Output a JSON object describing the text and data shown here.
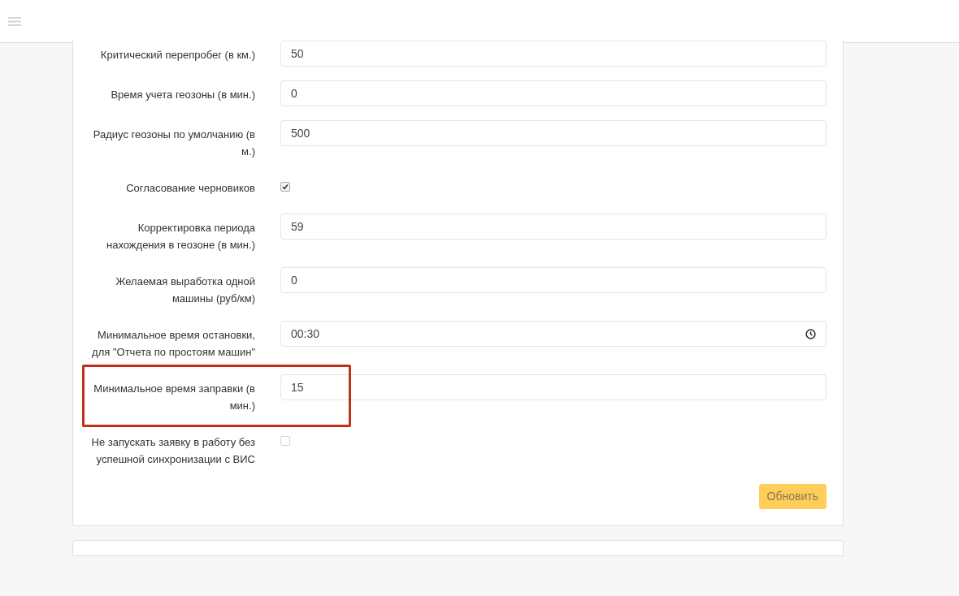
{
  "fields": [
    {
      "kind": "text",
      "label": "Критический перепробег (в км.)",
      "value": "50",
      "highlighted": false
    },
    {
      "kind": "text",
      "label": "Время учета геозоны (в мин.)",
      "value": "0",
      "highlighted": false
    },
    {
      "kind": "text",
      "label": "Радиус геозоны по умолчанию (в м.)",
      "value": "500",
      "highlighted": false
    },
    {
      "kind": "checkbox",
      "label": "Согласование черновиков",
      "checked": true,
      "highlighted": false
    },
    {
      "kind": "text",
      "label": "Корректировка периода нахождения в геозоне (в мин.)",
      "value": "59",
      "highlighted": false
    },
    {
      "kind": "text",
      "label": "Желаемая выработка одной машины (руб/км)",
      "value": "0",
      "highlighted": false
    },
    {
      "kind": "time",
      "label": "Минимальное время остановки, для \"Отчета по простоям машин\"",
      "value": "00:30",
      "highlighted": false
    },
    {
      "kind": "text",
      "label": "Минимальное время заправки (в мин.)",
      "value": "15",
      "highlighted": true
    },
    {
      "kind": "checkbox",
      "label": "Не запускать заявку в работу без успешной синхронизации с ВИС",
      "checked": false,
      "highlighted": false
    }
  ],
  "submit": "Обновить"
}
